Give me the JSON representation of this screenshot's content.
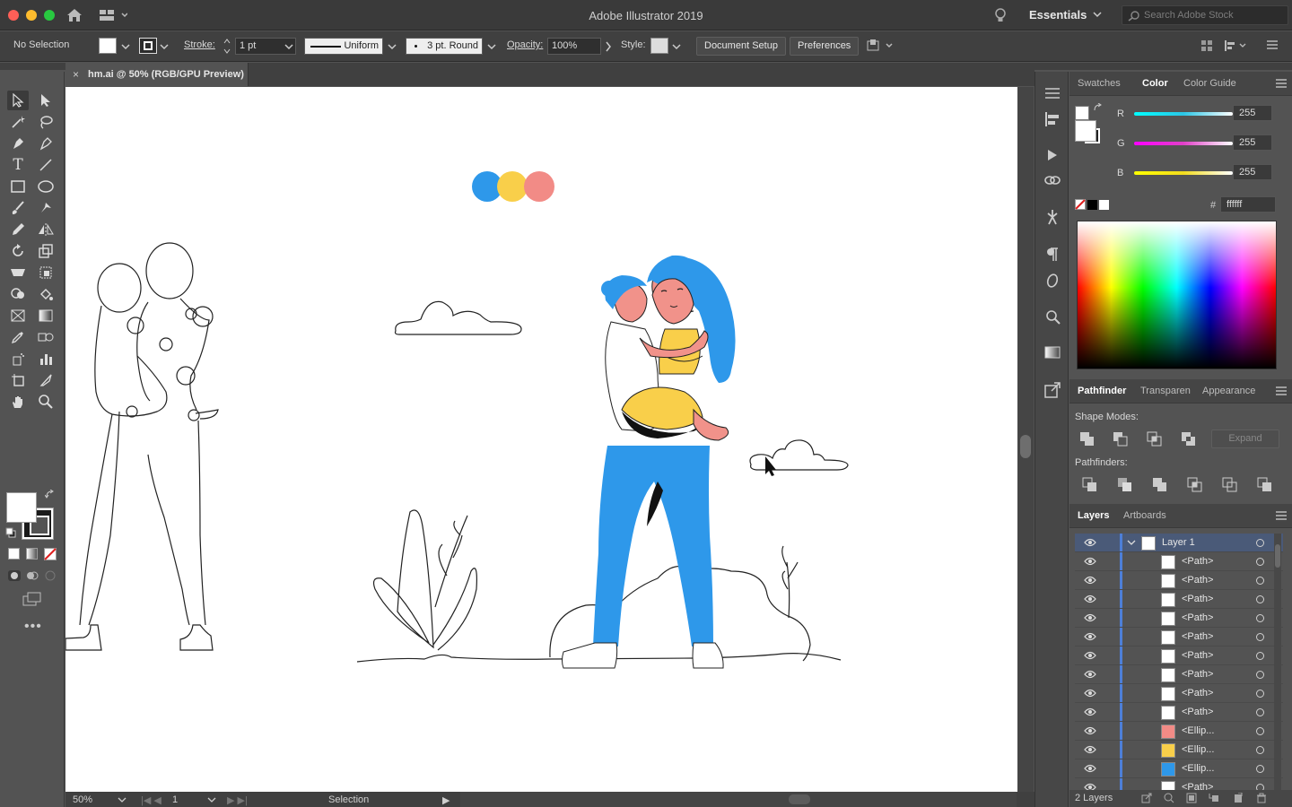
{
  "app": {
    "title": "Adobe Illustrator 2019",
    "workspace": "Essentials",
    "search_placeholder": "Search Adobe Stock"
  },
  "control": {
    "selection": "No Selection",
    "stroke_label": "Stroke:",
    "stroke_weight": "1 pt",
    "profile": "Uniform",
    "brush": "3 pt. Round",
    "opacity_label": "Opacity:",
    "opacity": "100%",
    "style_label": "Style:",
    "doc_setup": "Document Setup",
    "preferences": "Preferences"
  },
  "document": {
    "tab": "hm.ai @ 50% (RGB/GPU Preview)",
    "close": "×"
  },
  "status": {
    "zoom": "50%",
    "artboard": "1",
    "tool": "Selection"
  },
  "color_panel": {
    "tabs": [
      "Swatches",
      "Color",
      "Color Guide"
    ],
    "active_tab": "Color",
    "channels": [
      {
        "label": "R",
        "value": "255",
        "color": "#2bc6e6"
      },
      {
        "label": "G",
        "value": "255",
        "color": "#e040c8"
      },
      {
        "label": "B",
        "value": "255",
        "color": "#f2dc1e"
      }
    ],
    "hex_label": "#",
    "hex": "ffffff"
  },
  "pathfinder": {
    "tabs": [
      "Pathfinder",
      "Transparen",
      "Appearance"
    ],
    "shape_modes": "Shape Modes:",
    "expand": "Expand",
    "pathfinders": "Pathfinders:"
  },
  "layers": {
    "tabs": [
      "Layers",
      "Artboards"
    ],
    "footer": "2 Layers",
    "rows": [
      {
        "name": "Layer 1",
        "swatch": "#ffffff"
      },
      {
        "name": "<Path>",
        "swatch": "#ffffff"
      },
      {
        "name": "<Path>",
        "swatch": "#ffffff"
      },
      {
        "name": "<Path>",
        "swatch": "#ffffff"
      },
      {
        "name": "<Path>",
        "swatch": "#ffffff"
      },
      {
        "name": "<Path>",
        "swatch": "#ffffff"
      },
      {
        "name": "<Path>",
        "swatch": "#ffffff"
      },
      {
        "name": "<Path>",
        "swatch": "#ffffff"
      },
      {
        "name": "<Path>",
        "swatch": "#ffffff"
      },
      {
        "name": "<Path>",
        "swatch": "#ffffff"
      },
      {
        "name": "<Ellip...",
        "swatch": "#f28b86"
      },
      {
        "name": "<Ellip...",
        "swatch": "#f9cf4a"
      },
      {
        "name": "<Ellip...",
        "swatch": "#2e98ea"
      },
      {
        "name": "<Path>",
        "swatch": "#ffffff"
      }
    ]
  },
  "art": {
    "colors": {
      "blue": "#2e98ea",
      "yellow": "#f9cf4a",
      "pink": "#f28b86",
      "skin": "#f1928a"
    }
  }
}
